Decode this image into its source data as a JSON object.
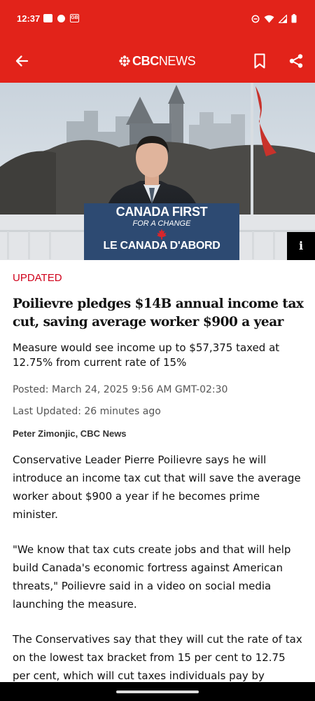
{
  "status_bar": {
    "time": "12:37",
    "left_icons": [
      "notification-icon",
      "app-icon",
      "gb-icon"
    ],
    "gb_label": "GB",
    "right_icons": [
      "do-not-disturb-icon",
      "wifi-icon",
      "signal-icon",
      "battery-icon"
    ]
  },
  "app_bar": {
    "logo_bold": "CBC",
    "logo_regular": "NEWS",
    "back_icon": "arrow-left-icon",
    "bookmark_icon": "bookmark-icon",
    "share_icon": "share-icon",
    "accent_color": "#e2231a"
  },
  "hero": {
    "podium_line1": "CANADA FIRST",
    "podium_line2": "FOR A CHANGE",
    "podium_line3": "LE CANADA D'ABORD",
    "info_label": "i"
  },
  "article": {
    "label": "UPDATED",
    "headline": "Poilievre pledges $14B annual income tax cut, saving average worker $900 a year",
    "deck": "Measure would see income up to $57,375 taxed at 12.75% from current rate of 15%",
    "posted": "Posted: March 24, 2025 9:56 AM GMT-02:30",
    "last_updated": "Last Updated: 26 minutes ago",
    "byline": "Peter Zimonjic, CBC News",
    "paragraphs": [
      "Conservative Leader Pierre Poilievre says he will introduce an income tax cut that will save the average worker about $900 a year if he becomes prime minister.",
      "\"We know that tax cuts create jobs and that will help build Canada's economic fortress against American threats,\" Poilievre said in a video on social media launching the measure.",
      "The Conservatives say that they will cut the rate of tax on the lowest tax bracket from 15 per cent to 12.75 per cent, which will cut taxes individuals pay by"
    ]
  }
}
